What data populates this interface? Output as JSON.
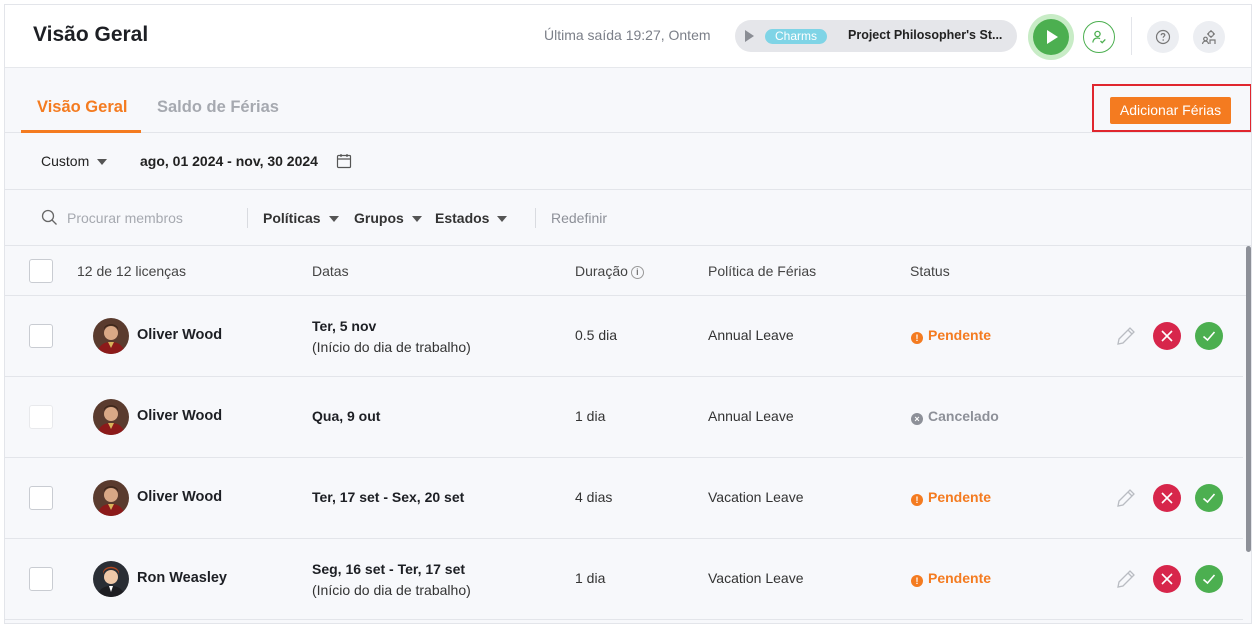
{
  "header": {
    "title": "Visão Geral",
    "last_exit": "Última saída 19:27, Ontem",
    "timer": {
      "tag": "Charms",
      "project": "Project Philosopher's St..."
    }
  },
  "tabs": [
    {
      "label": "Visão Geral",
      "active": true
    },
    {
      "label": "Saldo de Férias",
      "active": false
    }
  ],
  "add_button": {
    "label": "Adicionar Férias"
  },
  "date_filter": {
    "preset": "Custom",
    "range": "ago, 01 2024 - nov, 30 2024"
  },
  "filters": {
    "search_placeholder": "Procurar membros",
    "policies": "Políticas",
    "groups": "Grupos",
    "states": "Estados",
    "reset": "Redefinir"
  },
  "table": {
    "headers": {
      "count": "12 de 12 licenças",
      "dates": "Datas",
      "duration": "Duração",
      "policy": "Política de Férias",
      "status": "Status"
    },
    "rows": [
      {
        "member": "Oliver Wood",
        "date_main": "Ter, 5 nov",
        "date_sub": "(Início do dia de trabalho)",
        "duration": "0.5 dia",
        "policy": "Annual Leave",
        "status": "Pendente",
        "status_type": "pending"
      },
      {
        "member": "Oliver Wood",
        "date_main": "Qua, 9 out",
        "date_sub": "",
        "duration": "1 dia",
        "policy": "Annual Leave",
        "status": "Cancelado",
        "status_type": "cancelled"
      },
      {
        "member": "Oliver Wood",
        "date_main": "Ter, 17 set - Sex, 20 set",
        "date_sub": "",
        "duration": "4 dias",
        "policy": "Vacation Leave",
        "status": "Pendente",
        "status_type": "pending"
      },
      {
        "member": "Ron Weasley",
        "date_main": "Seg, 16 set - Ter, 17 set",
        "date_sub": "(Início do dia de trabalho)",
        "duration": "1 dia",
        "policy": "Vacation Leave",
        "status": "Pendente",
        "status_type": "pending"
      }
    ]
  },
  "colors": {
    "accent": "#f47b20",
    "reject": "#d7264b",
    "approve": "#4caf50",
    "highlight": "#e0262e"
  }
}
